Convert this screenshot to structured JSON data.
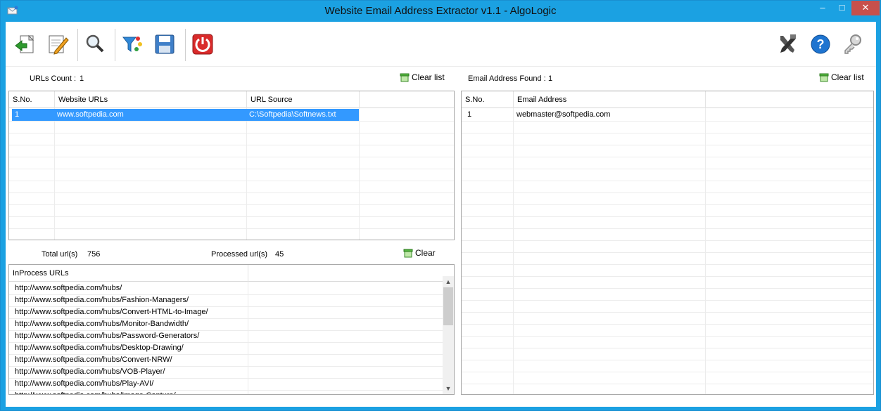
{
  "window": {
    "title": "Website Email Address Extractor v1.1 - AlgoLogic",
    "min": "–",
    "max": "□",
    "close": "✕"
  },
  "toolbar": {
    "left": [
      "import-icon",
      "edit-icon",
      "search-icon",
      "filter-icon",
      "save-icon",
      "power-icon"
    ],
    "right": [
      "tools-icon",
      "help-icon",
      "key-icon"
    ]
  },
  "urls": {
    "count_label": "URLs Count :",
    "count_value": "1",
    "clear_label": "Clear list",
    "columns": [
      "S.No.",
      "Website URLs",
      "URL Source"
    ],
    "rows": [
      {
        "sno": "1",
        "url": "www.softpedia.com",
        "source": "C:\\Softpedia\\Softnews.txt"
      }
    ]
  },
  "progress": {
    "total_label": "Total url(s)",
    "total_value": "756",
    "processed_label": "Processed url(s)",
    "processed_value": "45",
    "clear_label": "Clear"
  },
  "inprocess": {
    "column": "InProcess URLs",
    "rows": [
      "http://www.softpedia.com/hubs/",
      "http://www.softpedia.com/hubs/Fashion-Managers/",
      "http://www.softpedia.com/hubs/Convert-HTML-to-Image/",
      "http://www.softpedia.com/hubs/Monitor-Bandwidth/",
      "http://www.softpedia.com/hubs/Password-Generators/",
      "http://www.softpedia.com/hubs/Desktop-Drawing/",
      "http://www.softpedia.com/hubs/Convert-NRW/",
      "http://www.softpedia.com/hubs/VOB-Player/",
      "http://www.softpedia.com/hubs/Play-AVI/",
      "http://www.softpedia.com/hubs/Image-Capture/"
    ]
  },
  "emails": {
    "found_label": "Email Address Found :",
    "found_value": "1",
    "clear_label": "Clear list",
    "columns": [
      "S.No.",
      "Email Address"
    ],
    "rows": [
      {
        "sno": "1",
        "email": "webmaster@softpedia.com"
      }
    ]
  },
  "colors": {
    "titlebar": "#1ba1e2",
    "selection": "#3399ff",
    "close": "#c7504c"
  }
}
